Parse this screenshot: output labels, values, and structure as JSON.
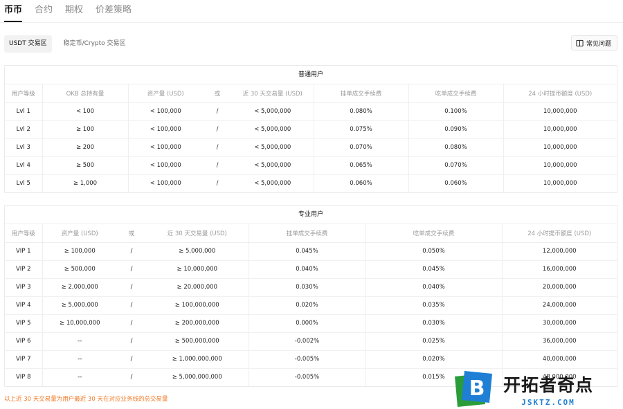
{
  "tabs": [
    {
      "label": "币币"
    },
    {
      "label": "合约"
    },
    {
      "label": "期权"
    },
    {
      "label": "价差策略"
    }
  ],
  "subtabs": [
    {
      "label": "USDT 交易区"
    },
    {
      "label": "稳定币/Crypto 交易区"
    }
  ],
  "faq": {
    "label": "常见问题",
    "icon": "book-icon"
  },
  "regular": {
    "title": "普通用户",
    "headers": [
      "用户等级",
      "OKB 总持有量",
      "资产量 (USD)",
      "或",
      "近 30 天交易量 (USD)",
      "挂单成交手续费",
      "吃单成交手续费",
      "24 小时提币额度 (USD)"
    ],
    "rows": [
      [
        "Lvl 1",
        "< 100",
        "< 100,000",
        "/",
        "< 5,000,000",
        "0.080%",
        "0.100%",
        "10,000,000"
      ],
      [
        "Lvl 2",
        "≥ 100",
        "< 100,000",
        "/",
        "< 5,000,000",
        "0.075%",
        "0.090%",
        "10,000,000"
      ],
      [
        "Lvl 3",
        "≥ 200",
        "< 100,000",
        "/",
        "< 5,000,000",
        "0.070%",
        "0.080%",
        "10,000,000"
      ],
      [
        "Lvl 4",
        "≥ 500",
        "< 100,000",
        "/",
        "< 5,000,000",
        "0.065%",
        "0.070%",
        "10,000,000"
      ],
      [
        "Lvl 5",
        "≥ 1,000",
        "< 100,000",
        "/",
        "< 5,000,000",
        "0.060%",
        "0.060%",
        "10,000,000"
      ]
    ]
  },
  "pro": {
    "title": "专业用户",
    "headers": [
      "用户等级",
      "资产量 (USD)",
      "或",
      "近 30 天交易量 (USD)",
      "挂单成交手续费",
      "吃单成交手续费",
      "24 小时提币额度 (USD)"
    ],
    "rows": [
      [
        "VIP 1",
        "≥ 100,000",
        "/",
        "≥ 5,000,000",
        "0.045%",
        "0.050%",
        "12,000,000"
      ],
      [
        "VIP 2",
        "≥ 500,000",
        "/",
        "≥ 10,000,000",
        "0.040%",
        "0.045%",
        "16,000,000"
      ],
      [
        "VIP 3",
        "≥ 2,000,000",
        "/",
        "≥ 20,000,000",
        "0.030%",
        "0.040%",
        "20,000,000"
      ],
      [
        "VIP 4",
        "≥ 5,000,000",
        "/",
        "≥ 100,000,000",
        "0.020%",
        "0.035%",
        "24,000,000"
      ],
      [
        "VIP 5",
        "≥ 10,000,000",
        "/",
        "≥ 200,000,000",
        "0.000%",
        "0.030%",
        "30,000,000"
      ],
      [
        "VIP 6",
        "--",
        "/",
        "≥ 500,000,000",
        "-0.002%",
        "0.025%",
        "36,000,000"
      ],
      [
        "VIP 7",
        "--",
        "/",
        "≥ 1,000,000,000",
        "-0.005%",
        "0.020%",
        "40,000,000"
      ],
      [
        "VIP 8",
        "--",
        "/",
        "≥ 5,000,000,000",
        "-0.005%",
        "0.015%",
        "48,000,000"
      ]
    ]
  },
  "footnote": "以上近 30 天交易量为用户最近 30 天在对应业务线的总交易量",
  "watermark": {
    "cn": "开拓者奇点",
    "en": "JSKTZ.COM",
    "logo_letter": "B"
  },
  "colors": {
    "accent_text": "#111111",
    "footnote": "#f07a25",
    "watermark_en": "#1e7fd4"
  }
}
